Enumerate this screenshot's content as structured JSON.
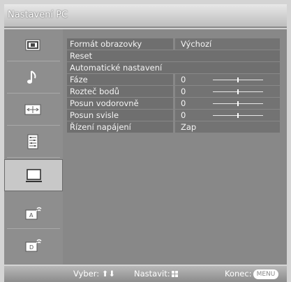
{
  "title": "Nastavení PC",
  "sidebar": {
    "items": [
      {
        "icon": "picture-icon",
        "active": false
      },
      {
        "icon": "sound-icon",
        "active": false
      },
      {
        "icon": "screen-icon",
        "active": false
      },
      {
        "icon": "settings-list-icon",
        "active": false
      },
      {
        "icon": "pc-monitor-icon",
        "active": true
      },
      {
        "icon": "analog-tuning-icon",
        "active": false
      },
      {
        "icon": "digital-tuning-icon",
        "active": false
      }
    ]
  },
  "menu": {
    "rows": [
      {
        "label": "Formát obrazovky",
        "value": "Výchozí"
      },
      {
        "label": "Reset"
      },
      {
        "label": "Automatické nastavení"
      },
      {
        "label": "Fáze",
        "value": "0",
        "slider": 0.5
      },
      {
        "label": "Rozteč bodů",
        "value": "0",
        "slider": 0.5
      },
      {
        "label": "Posun vodorovně",
        "value": "0",
        "slider": 0.5
      },
      {
        "label": "Posun svisle",
        "value": "0",
        "slider": 0.5
      },
      {
        "label": "Řízení napájení",
        "value": "Zap"
      }
    ]
  },
  "footer": {
    "select_label": "Vyber:",
    "set_label": "Nastavit:",
    "exit_label": "Konec:",
    "menu_key": "MENU"
  }
}
